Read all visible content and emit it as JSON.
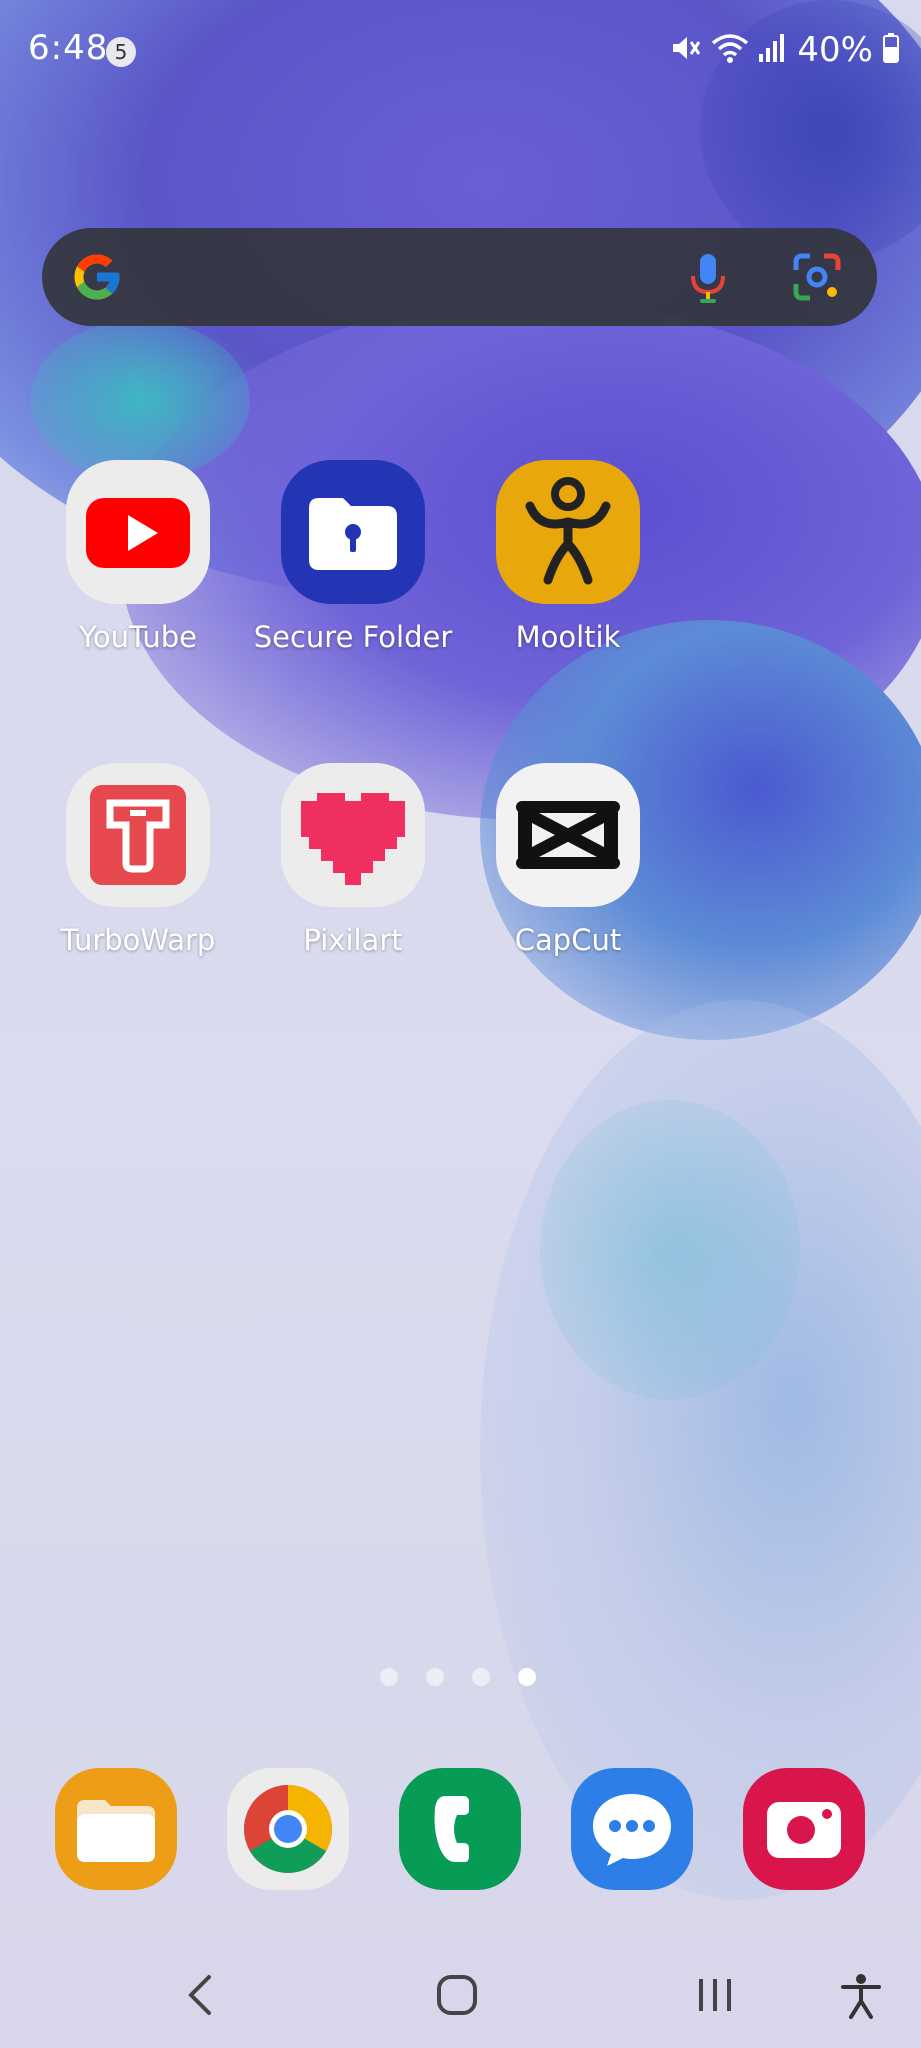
{
  "status_bar": {
    "time": "6:48",
    "notification_count": "5",
    "battery": "40%"
  },
  "search_bar": {
    "logo": "google-g-icon",
    "mic": "microphone-icon",
    "lens": "google-lens-icon"
  },
  "apps": [
    {
      "label": "YouTube",
      "icon": "youtube-icon"
    },
    {
      "label": "Secure Folder",
      "icon": "secure-folder-icon"
    },
    {
      "label": "Mooltik",
      "icon": "mooltik-icon"
    },
    {
      "label": "TurboWarp",
      "icon": "turbowarp-icon"
    },
    {
      "label": "Pixilart",
      "icon": "pixilart-icon"
    },
    {
      "label": "CapCut",
      "icon": "capcut-icon"
    }
  ],
  "page_indicator": {
    "count": 4,
    "active_index": 3
  },
  "dock": [
    {
      "icon": "my-files-icon"
    },
    {
      "icon": "chrome-icon"
    },
    {
      "icon": "phone-icon"
    },
    {
      "icon": "messages-icon"
    },
    {
      "icon": "camera-icon"
    }
  ],
  "nav_bar": {
    "back": "back-icon",
    "home": "home-icon",
    "recents": "recents-icon",
    "accessibility": "accessibility-icon"
  },
  "colors": {
    "youtube_red": "#ff0000",
    "secure_folder_blue": "#2335b4",
    "mooltik_yellow": "#e8a80c",
    "turbowarp_red": "#e5484d",
    "pixilart_pink": "#ef2f5f",
    "files_orange": "#ed9e16",
    "phone_green": "#079c56",
    "messages_blue": "#2d7ee6",
    "camera_red": "#d8164c"
  }
}
